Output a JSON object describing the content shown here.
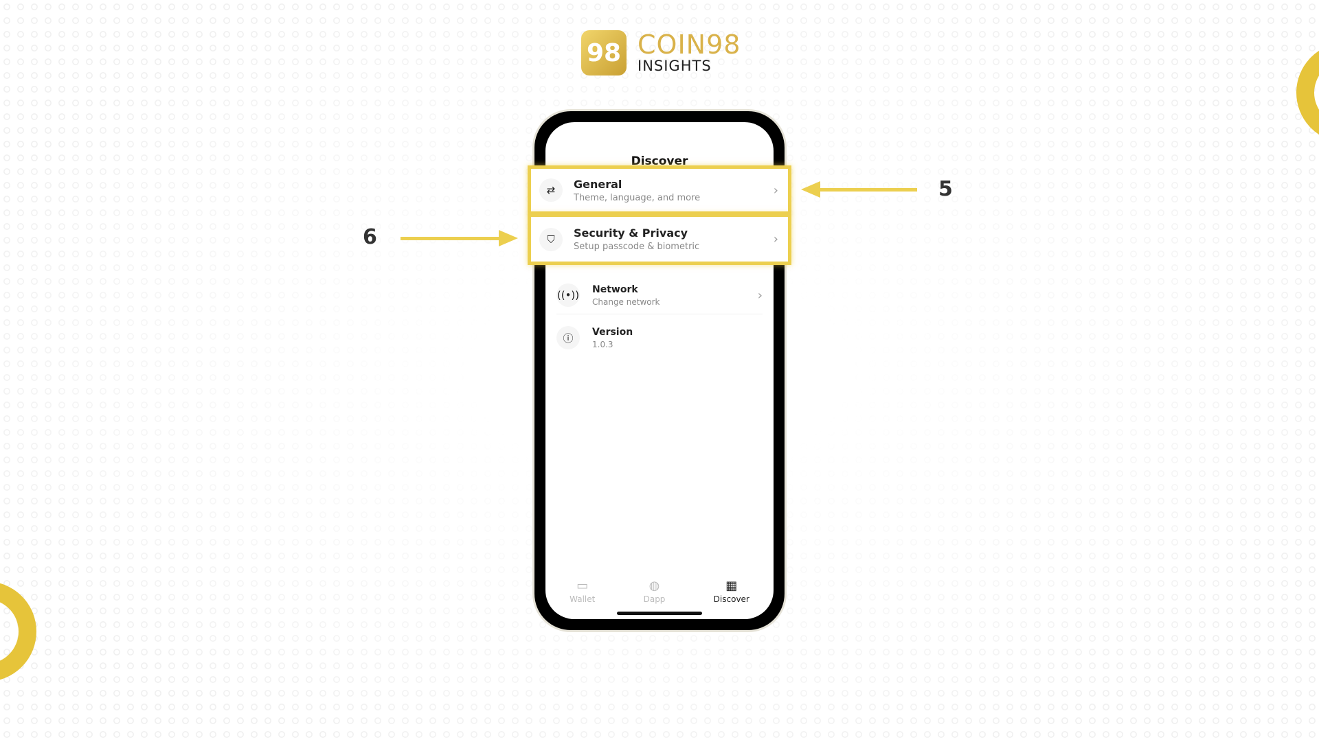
{
  "brand": {
    "logo_mark": "98",
    "name": "COIN98",
    "sub": "INSIGHTS"
  },
  "screen": {
    "title": "Discover"
  },
  "settings": [
    {
      "icon": "sliders-icon",
      "title": "General",
      "subtitle": "Theme, language, and more"
    },
    {
      "icon": "shield-icon",
      "title": "Security & Privacy",
      "subtitle": "Setup passcode & biometric"
    },
    {
      "icon": "network-icon",
      "title": "Network",
      "subtitle": "Change network"
    },
    {
      "icon": "info-icon",
      "title": "Version",
      "subtitle": "1.0.3"
    }
  ],
  "tabs": [
    {
      "label": "Wallet",
      "icon": "wallet-icon"
    },
    {
      "label": "Dapp",
      "icon": "globe-icon"
    },
    {
      "label": "Discover",
      "icon": "grid-icon",
      "active": true
    }
  ],
  "annotations": {
    "step_general": "5",
    "step_security": "6"
  },
  "colors": {
    "highlight": "#eccf4f",
    "brand_gold": "#d9b24a"
  }
}
